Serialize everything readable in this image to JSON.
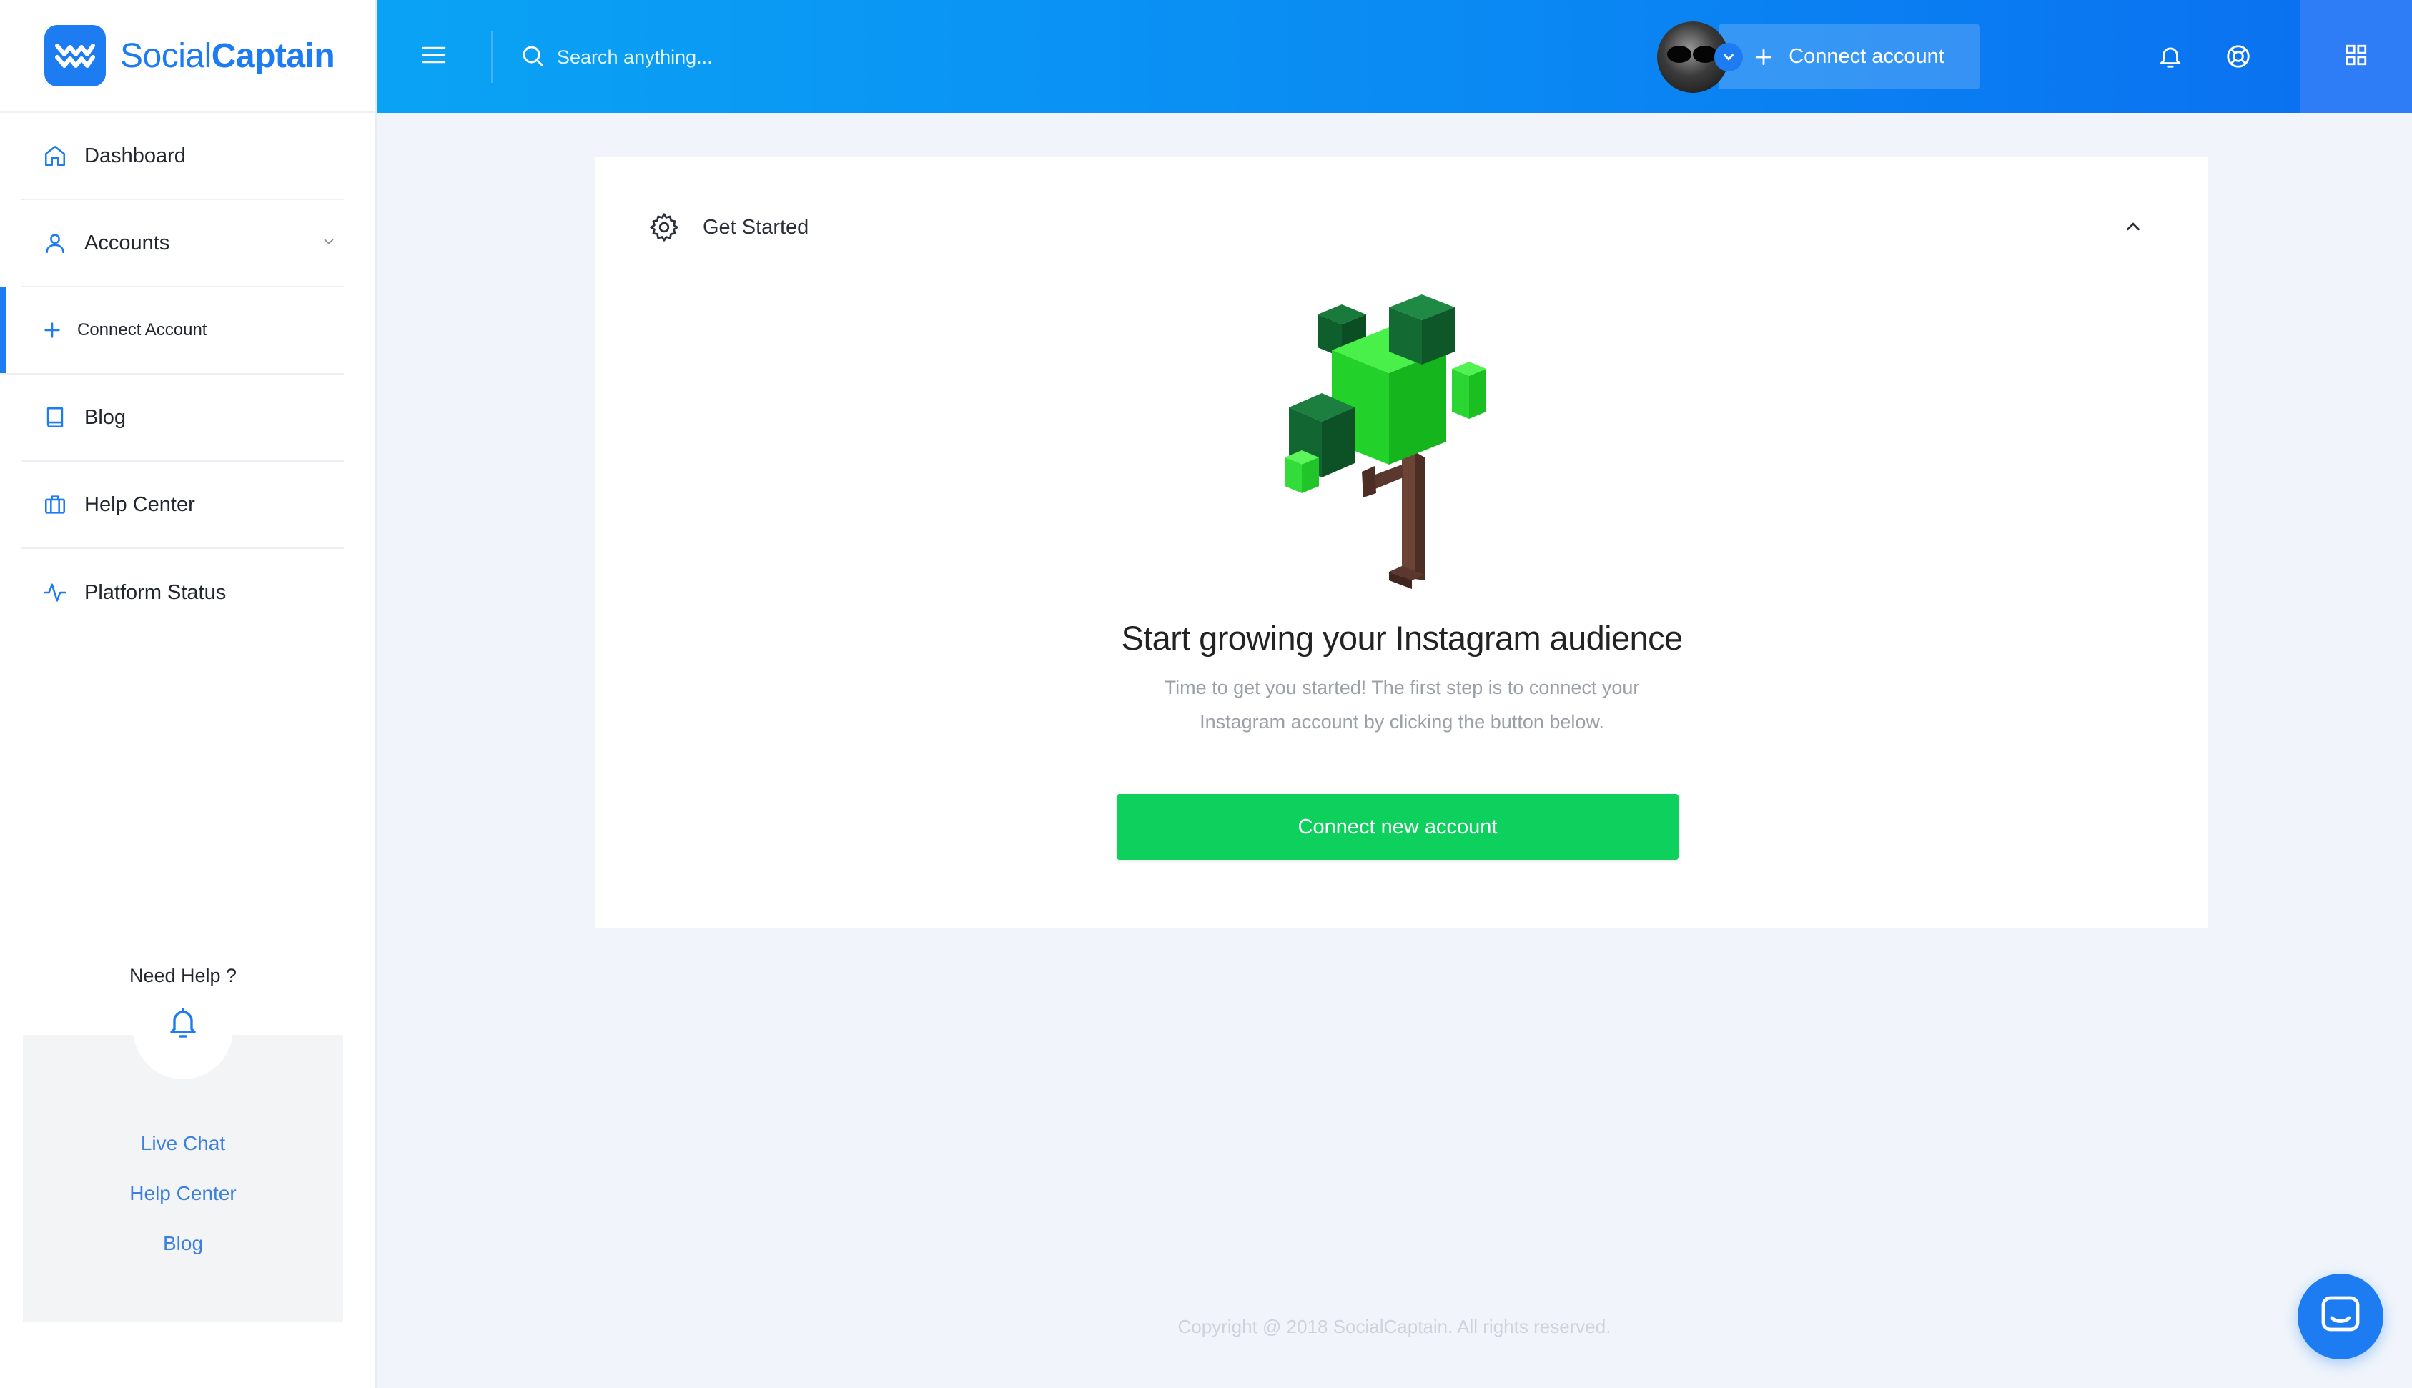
{
  "brand": {
    "name_part1": "Social",
    "name_part2": "Captain"
  },
  "sidebar": {
    "items": [
      {
        "label": "Dashboard",
        "icon": "home-icon"
      },
      {
        "label": "Accounts",
        "icon": "user-icon"
      },
      {
        "label": "Connect Account",
        "icon": "plus-icon",
        "active": true
      },
      {
        "label": "Blog",
        "icon": "book-icon"
      },
      {
        "label": "Help Center",
        "icon": "briefcase-icon"
      },
      {
        "label": "Platform Status",
        "icon": "activity-icon"
      }
    ],
    "help": {
      "title": "Need Help ?",
      "links": [
        "Live Chat",
        "Help Center",
        "Blog"
      ]
    }
  },
  "header": {
    "search_placeholder": "Search anything...",
    "connect_button": "Connect account"
  },
  "card": {
    "section_title": "Get Started",
    "heading": "Start growing your Instagram audience",
    "text_line1": "Time to get you started! The first step is to connect your",
    "text_line2": "Instagram account by clicking the button below.",
    "cta": "Connect new account"
  },
  "footer": {
    "copyright": "Copyright @ 2018 SocialCaptain. All rights reserved."
  },
  "colors": {
    "accent": "#1e7cf2",
    "header_gradient_start": "#0aa3f4",
    "header_gradient_end": "#0a6ff0",
    "cta_green": "#0ed05c",
    "background": "#f1f5fb"
  }
}
